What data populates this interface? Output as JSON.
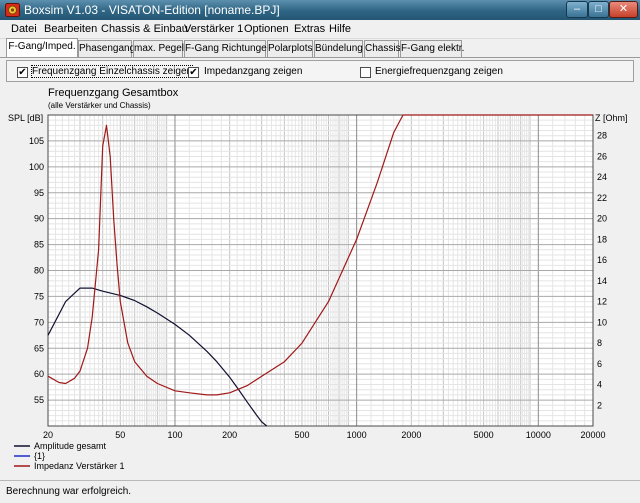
{
  "window": {
    "title": "Boxsim V1.03 - VISATON-Edition [noname.BPJ]",
    "minimize_glyph": "–",
    "maximize_glyph": "□",
    "close_glyph": "✕",
    "icon": "boxsim-app-icon"
  },
  "menu": [
    "Datei",
    "Bearbeiten",
    "Chassis & Einbau",
    "Verstärker 1",
    "Optionen",
    "Extras",
    "Hilfe"
  ],
  "tabs": [
    "F-Gang/Imped.",
    "Phasengang",
    "max. Pegel",
    "F-Gang Richtungen",
    "Polarplots",
    "Bündelung",
    "Chassis",
    "F-Gang elektr."
  ],
  "active_tab": 0,
  "options": [
    {
      "label": "Frequenzgang Einzelchassis zeigen",
      "checked": true
    },
    {
      "label": "Impedanzgang zeigen",
      "checked": true
    },
    {
      "label": "Energiefrequenzgang zeigen",
      "checked": false
    }
  ],
  "status": "Berechnung war erfolgreich.",
  "colors": {
    "amplitude": "#101030",
    "chassis": "#1c2dc8",
    "impedance": "#a01818",
    "grid": "#c4c4c4"
  },
  "chart_data": {
    "type": "line",
    "title": "Frequenzgang Gesamtbox",
    "subtitle": "(alle Verstärker und Chassis)",
    "ylabel": "SPL [dB]",
    "y2label": "Z [Ohm]",
    "x_scale": "log",
    "xlim": [
      20,
      20000
    ],
    "ylim": [
      50,
      110
    ],
    "y2lim": [
      0,
      30
    ],
    "grid": true,
    "x_ticks": [
      20,
      50,
      100,
      200,
      500,
      1000,
      2000,
      5000,
      10000,
      20000
    ],
    "y_ticks": [
      55,
      60,
      65,
      70,
      75,
      80,
      85,
      90,
      95,
      100,
      105
    ],
    "y2_ticks": [
      2,
      4,
      6,
      8,
      10,
      12,
      14,
      16,
      18,
      20,
      22,
      24,
      26,
      28
    ],
    "legend": [
      "Amplitude gesamt",
      "{1}",
      "Impedanz Verstärker 1"
    ],
    "legend_placement": "bottom-left",
    "series": [
      {
        "name": "Amplitude gesamt",
        "axis": "left",
        "x": [
          20,
          25,
          30,
          35,
          40,
          50,
          60,
          70,
          80,
          100,
          120,
          150,
          170,
          200,
          220,
          250,
          280,
          300,
          320
        ],
        "y": [
          67.5,
          74,
          76.6,
          76.6,
          76,
          75.2,
          74.2,
          73,
          71.8,
          69.6,
          67.5,
          64.4,
          62.4,
          59.4,
          57.4,
          54.6,
          52.2,
          50.8,
          50
        ]
      },
      {
        "name": "Impedanz Verstärker 1",
        "axis": "right",
        "x": [
          20,
          23,
          25,
          28,
          30,
          33,
          35,
          38,
          40,
          42,
          44,
          46,
          48,
          50,
          55,
          60,
          70,
          80,
          100,
          120,
          150,
          170,
          200,
          250,
          300,
          400,
          500,
          700,
          1000,
          1300,
          1600,
          1800,
          1900,
          20000
        ],
        "y": [
          4.8,
          4.2,
          4.1,
          4.6,
          5.3,
          7.5,
          10.5,
          17,
          27,
          29,
          26,
          20,
          15.5,
          12,
          8,
          6.2,
          4.8,
          4.1,
          3.4,
          3.2,
          3.0,
          3.0,
          3.2,
          3.9,
          4.8,
          6.2,
          8,
          12,
          18,
          23.5,
          28.3,
          30,
          30,
          30
        ]
      }
    ]
  }
}
